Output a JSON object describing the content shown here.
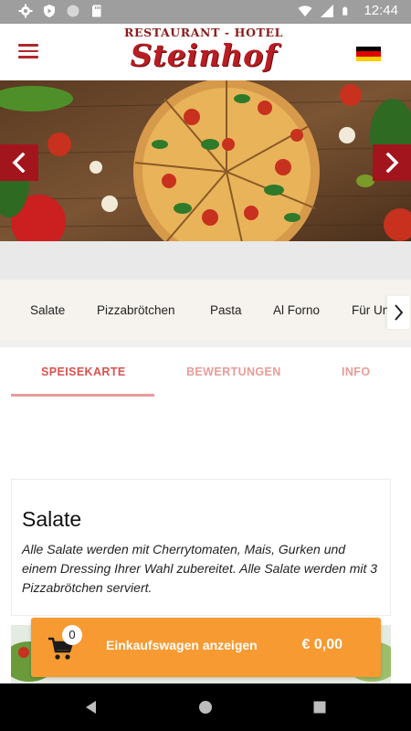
{
  "status_bar": {
    "time": "12:44",
    "icons": [
      "gear-icon",
      "shield-icon",
      "circle-icon",
      "sd-card-icon",
      "wifi-icon",
      "signal-icon",
      "battery-icon"
    ]
  },
  "header": {
    "logo_top": "RESTAURANT - HOTEL",
    "logo_main": "Steinhof",
    "menu_icon": "hamburger-menu-icon",
    "language_flag": "german-flag-icon"
  },
  "hero": {
    "prev_icon": "chevron-left-icon",
    "next_icon": "chevron-right-icon"
  },
  "categories": {
    "items": [
      "Salate",
      "Pizzabrötchen",
      "Pasta",
      "Al Forno",
      "Für Un"
    ],
    "next_icon": "chevron-right-icon"
  },
  "tabs": {
    "items": [
      {
        "label": "SPEISEKARTE",
        "active": true
      },
      {
        "label": "BEWERTUNGEN",
        "active": false
      },
      {
        "label": "INFO",
        "active": false
      }
    ]
  },
  "section": {
    "title": "Salate",
    "description": "Alle Salate werden mit Cherrytomaten, Mais, Gurken und einem Dressing Ihrer Wahl zubereitet. Alle Salate werden mit 3 Pizzabrötchen serviert."
  },
  "cart": {
    "count": "0",
    "label": "Einkaufswagen anzeigen",
    "total": "€ 0,00",
    "icon": "shopping-cart-icon"
  },
  "nav": {
    "icons": [
      "back-triangle-icon",
      "home-circle-icon",
      "recents-square-icon"
    ]
  },
  "colors": {
    "brand_red": "#a3151c",
    "tab_active": "#d9534f",
    "cart_orange": "#f79a32"
  }
}
